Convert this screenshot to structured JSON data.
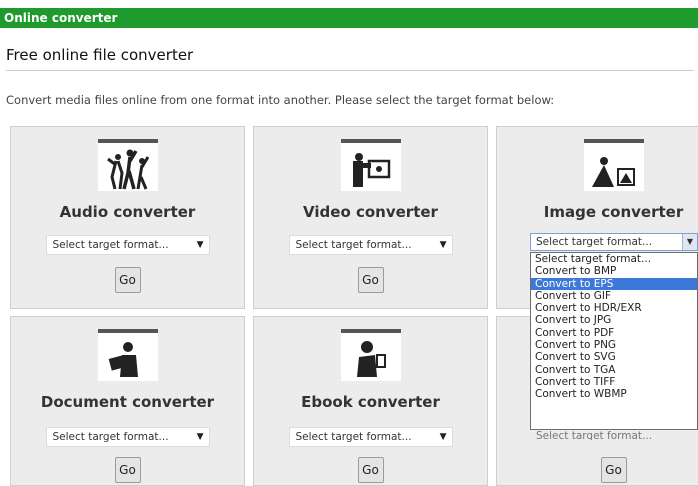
{
  "header": {
    "title": "Online converter"
  },
  "page": {
    "title": "Free online file converter",
    "intro": "Convert media files online from one format into another. Please select the target format below:"
  },
  "cards": [
    {
      "title": "Audio converter",
      "select": "Select target format...",
      "go": "Go",
      "icon": "audio-people-icon"
    },
    {
      "title": "Video converter",
      "select": "Select target format...",
      "go": "Go",
      "icon": "video-camera-person-icon"
    },
    {
      "title": "Image converter",
      "select": "Select target format...",
      "go": "Go",
      "icon": "image-photographer-icon"
    },
    {
      "title": "Document converter",
      "select": "Select target format...",
      "go": "Go",
      "icon": "document-reader-icon"
    },
    {
      "title": "Ebook converter",
      "select": "Select target format...",
      "go": "Go",
      "icon": "ebook-reader-icon"
    },
    {
      "title": "",
      "select": "Select target format...",
      "go": "Go",
      "icon": ""
    }
  ],
  "image_dropdown": {
    "value": "Select target format...",
    "options": [
      "Select target format...",
      "Convert to BMP",
      "Convert to EPS",
      "Convert to GIF",
      "Convert to HDR/EXR",
      "Convert to JPG",
      "Convert to PDF",
      "Convert to PNG",
      "Convert to SVG",
      "Convert to TGA",
      "Convert to TIFF",
      "Convert to WBMP"
    ],
    "highlighted_index": 2
  }
}
